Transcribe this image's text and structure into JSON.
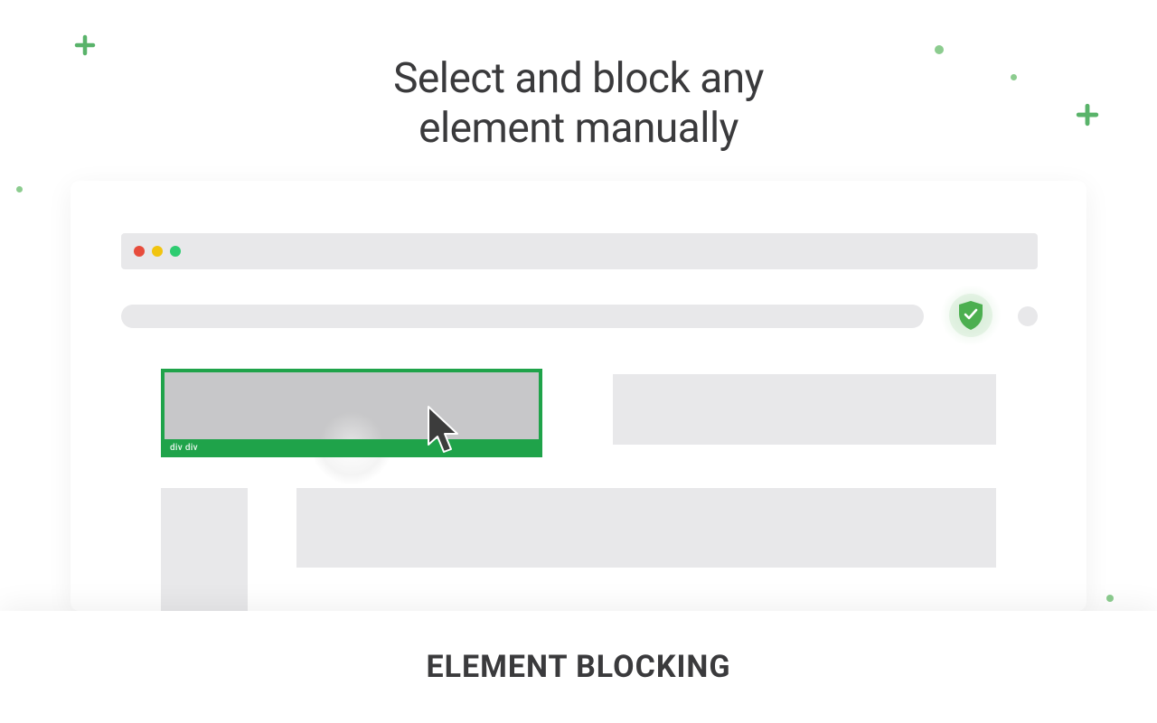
{
  "headline_line1": "Select and block any",
  "headline_line2": "element manually",
  "selection_label": "div div",
  "footer_title": "ELEMENT BLOCKING",
  "colors": {
    "accent": "#1fa34a",
    "shield": "#4caf50"
  }
}
